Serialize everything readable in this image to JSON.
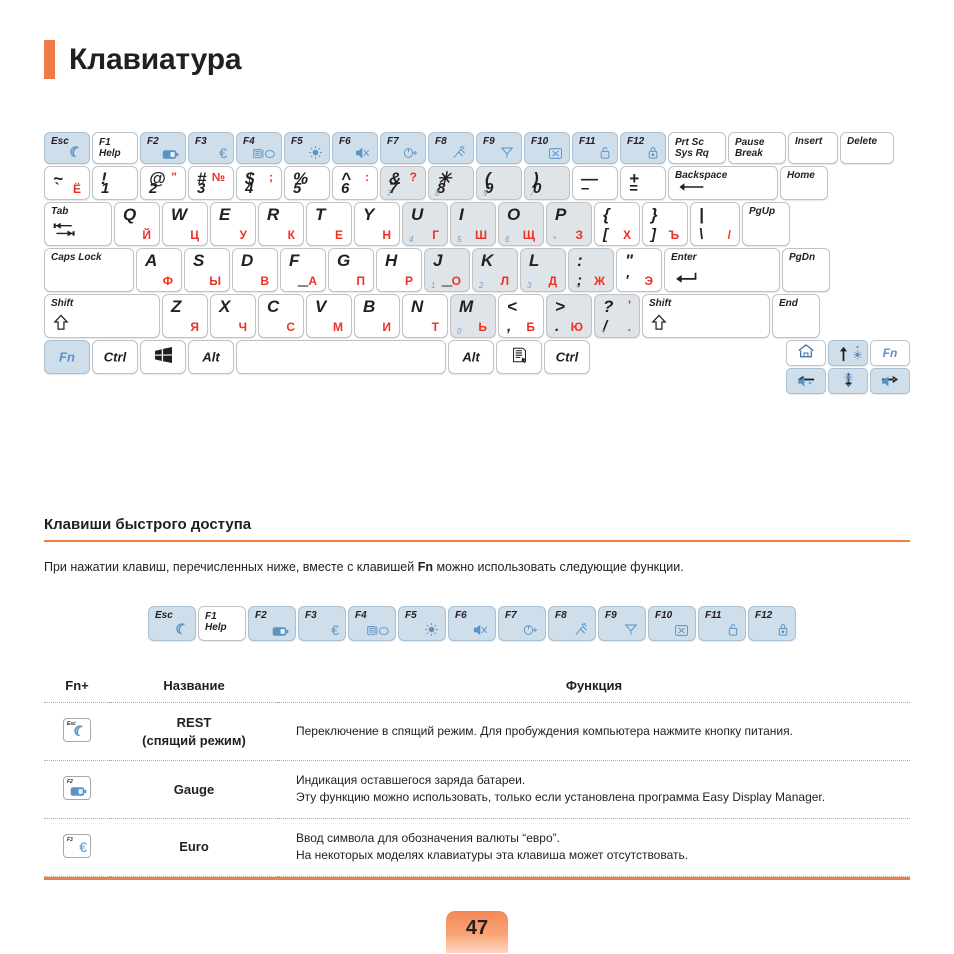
{
  "page": {
    "title": "Клавиатура",
    "number": "47",
    "accent_color": "#f07b47",
    "key_blue": "#cfdeeb",
    "key_numpad": "#dfe4e8",
    "red_label_color": "#ee3124",
    "blue_label_color": "#5b93c6"
  },
  "keyboard": {
    "row_fn": [
      {
        "cap": "Esc",
        "glyph": "moon-icon",
        "style": "blue"
      },
      {
        "cap": "F1",
        "cap2": "Help",
        "style": "white"
      },
      {
        "cap": "F2",
        "glyph": "battery-icon",
        "style": "blue"
      },
      {
        "cap": "F3",
        "glyph": "euro-icon",
        "style": "blue"
      },
      {
        "cap": "F4",
        "glyph": "display-icon",
        "style": "blue"
      },
      {
        "cap": "F5",
        "glyph": "brightness-icon",
        "style": "blue"
      },
      {
        "cap": "F6",
        "glyph": "mute-icon",
        "style": "blue"
      },
      {
        "cap": "F7",
        "glyph": "touchpad-icon",
        "style": "blue"
      },
      {
        "cap": "F8",
        "glyph": "wireless-icon",
        "style": "blue"
      },
      {
        "cap": "F9",
        "glyph": "antenna-icon",
        "style": "blue"
      },
      {
        "cap": "F10",
        "glyph": "screen-off-icon",
        "style": "blue"
      },
      {
        "cap": "F11",
        "glyph": "lock-open-icon",
        "style": "blue"
      },
      {
        "cap": "F12",
        "glyph": "lock-closed-icon",
        "style": "blue"
      },
      {
        "cap": "Prt Sc",
        "cap2": "Sys Rq",
        "style": "white"
      },
      {
        "cap": "Pause",
        "cap2": "Break",
        "style": "white"
      },
      {
        "cap": "Insert",
        "style": "white"
      },
      {
        "cap": "Delete",
        "style": "white"
      }
    ],
    "row_num": [
      {
        "top": "~",
        "bottom": "`",
        "red_br": "Ё",
        "style": "white"
      },
      {
        "top": "!",
        "bottom": "1",
        "style": "white"
      },
      {
        "top": "@",
        "bottom": "2",
        "red_tr": "\"",
        "style": "white"
      },
      {
        "top": "#",
        "bottom": "3",
        "red_tr": "№",
        "style": "white"
      },
      {
        "top": "$",
        "bottom": "4",
        "red_tr": ";",
        "style": "white"
      },
      {
        "top": "%",
        "bottom": "5",
        "style": "white"
      },
      {
        "top": "^",
        "bottom": "6",
        "red_tr": ":",
        "style": "white"
      },
      {
        "top": "&",
        "bottom": "7",
        "red_tr": "?",
        "numpad": "7",
        "style": "numpad"
      },
      {
        "top": "✳",
        "bottom": "8",
        "numpad": "8",
        "style": "numpad"
      },
      {
        "top": "(",
        "bottom": "9",
        "numpad": "9",
        "style": "numpad"
      },
      {
        "top": ")",
        "bottom": "0",
        "numpad": "/",
        "style": "numpad"
      },
      {
        "top": "—",
        "bottom": "–",
        "style": "white"
      },
      {
        "top": "+",
        "bottom": "=",
        "style": "white"
      },
      {
        "cap": "Backspace",
        "glyph": "arrow-left-icon",
        "style": "white"
      },
      {
        "cap": "Home",
        "style": "white"
      }
    ],
    "row_q": [
      {
        "cap": "Tab",
        "glyph": "tab-arrows-icon",
        "style": "white"
      },
      {
        "top": "Q",
        "red_br": "Й",
        "style": "white"
      },
      {
        "top": "W",
        "red_br": "Ц",
        "style": "white"
      },
      {
        "top": "E",
        "red_br": "У",
        "style": "white"
      },
      {
        "top": "R",
        "red_br": "К",
        "style": "white"
      },
      {
        "top": "T",
        "red_br": "Е",
        "style": "white"
      },
      {
        "top": "Y",
        "red_br": "Н",
        "style": "white"
      },
      {
        "top": "U",
        "red_br": "Г",
        "numpad": "4",
        "style": "numpad"
      },
      {
        "top": "I",
        "red_br": "Ш",
        "numpad": "5",
        "style": "numpad"
      },
      {
        "top": "O",
        "red_br": "Щ",
        "numpad": "6",
        "style": "numpad"
      },
      {
        "top": "P",
        "red_br": "З",
        "numpad": "*",
        "style": "numpad"
      },
      {
        "top": "{",
        "bottom": "[",
        "red_br": "Х",
        "style": "white"
      },
      {
        "top": "}",
        "bottom": "]",
        "red_br": "Ъ",
        "style": "white"
      },
      {
        "top": "|",
        "bottom": "\\",
        "red_br": "/",
        "style": "white"
      },
      {
        "cap": "PgUp",
        "style": "white"
      }
    ],
    "row_a": [
      {
        "cap": "Caps Lock",
        "style": "white"
      },
      {
        "top": "A",
        "red_br": "Ф",
        "style": "white"
      },
      {
        "top": "S",
        "red_br": "Ы",
        "style": "white"
      },
      {
        "top": "D",
        "red_br": "В",
        "style": "white"
      },
      {
        "top": "F",
        "red_br": "А",
        "homebar": true,
        "style": "white"
      },
      {
        "top": "G",
        "red_br": "П",
        "style": "white"
      },
      {
        "top": "H",
        "red_br": "Р",
        "style": "white"
      },
      {
        "top": "J",
        "red_br": "О",
        "numpad": "1",
        "homebar": true,
        "style": "numpad"
      },
      {
        "top": "K",
        "red_br": "Л",
        "numpad": "2",
        "style": "numpad"
      },
      {
        "top": "L",
        "red_br": "Д",
        "numpad": "3",
        "style": "numpad"
      },
      {
        "top": ":",
        "bottom": ";",
        "red_br": "Ж",
        "numpad": "-",
        "style": "numpad"
      },
      {
        "top": "\"",
        "bottom": "'",
        "red_br": "Э",
        "style": "white"
      },
      {
        "cap": "Enter",
        "glyph": "enter-arrow-icon",
        "style": "white"
      },
      {
        "cap": "PgDn",
        "style": "white"
      }
    ],
    "row_z": [
      {
        "cap": "Shift",
        "glyph": "shift-up-icon",
        "style": "white"
      },
      {
        "top": "Z",
        "red_br": "Я",
        "style": "white"
      },
      {
        "top": "X",
        "red_br": "Ч",
        "style": "white"
      },
      {
        "top": "C",
        "red_br": "С",
        "style": "white"
      },
      {
        "top": "V",
        "red_br": "М",
        "style": "white"
      },
      {
        "top": "B",
        "red_br": "И",
        "style": "white"
      },
      {
        "top": "N",
        "red_br": "Т",
        "style": "white"
      },
      {
        "top": "M",
        "red_br": "Ь",
        "numpad": "0",
        "style": "numpad"
      },
      {
        "top": "<",
        "bottom": ",",
        "red_br": "Б",
        "style": "white"
      },
      {
        "top": ">",
        "bottom": ".",
        "red_br": "Ю",
        "numpad": ".",
        "style": "numpad"
      },
      {
        "top": "?",
        "bottom": "/",
        "red_tr": "'",
        "red_br": ".",
        "numpad": "+",
        "style": "numpad"
      },
      {
        "cap": "Shift",
        "glyph": "shift-up-icon",
        "style": "white"
      },
      {
        "cap": "End",
        "style": "white"
      }
    ],
    "row_bottom": [
      {
        "cap": "Fn",
        "style": "blue-fn"
      },
      {
        "cap": "Ctrl",
        "style": "white"
      },
      {
        "cap": "windows-icon",
        "style": "white"
      },
      {
        "cap": "Alt",
        "style": "white"
      },
      {
        "cap": "",
        "style": "white"
      },
      {
        "cap": "Alt",
        "style": "white"
      },
      {
        "cap": "menu-icon",
        "style": "white"
      },
      {
        "cap": "Ctrl",
        "style": "white"
      }
    ],
    "arrow_cluster": {
      "top": [
        {
          "glyph": "home-house-icon",
          "style": "white"
        },
        {
          "glyph": "arrow-up-icon",
          "sub": "brightness-up-icon",
          "style": "blue"
        },
        {
          "label": "Fn",
          "style": "white-fn"
        }
      ],
      "bottom": [
        {
          "glyph": "arrow-left-icon",
          "sub": "volume-down-icon",
          "style": "blue"
        },
        {
          "glyph": "arrow-down-icon",
          "sub": "brightness-down-icon",
          "style": "blue"
        },
        {
          "glyph": "arrow-right-icon",
          "sub": "volume-up-icon",
          "style": "blue"
        }
      ]
    }
  },
  "hotkeys_section": {
    "title": "Клавиши быстрого доступа",
    "intro_before": "При нажатии клавиш, перечисленных ниже, вместе с клавишей ",
    "intro_bold": "Fn",
    "intro_after": " можно использовать следующие функции.",
    "strip": [
      {
        "cap": "Esc",
        "glyph": "moon-icon",
        "style": "blue"
      },
      {
        "cap": "F1",
        "cap2": "Help",
        "style": "white"
      },
      {
        "cap": "F2",
        "glyph": "battery-icon",
        "style": "blue"
      },
      {
        "cap": "F3",
        "glyph": "euro-icon",
        "style": "blue"
      },
      {
        "cap": "F4",
        "glyph": "display-icon",
        "style": "blue"
      },
      {
        "cap": "F5",
        "glyph": "brightness-icon",
        "style": "blue"
      },
      {
        "cap": "F6",
        "glyph": "mute-icon",
        "style": "blue"
      },
      {
        "cap": "F7",
        "glyph": "touchpad-icon",
        "style": "blue"
      },
      {
        "cap": "F8",
        "glyph": "wireless-icon",
        "style": "blue"
      },
      {
        "cap": "F9",
        "glyph": "antenna-icon",
        "style": "blue"
      },
      {
        "cap": "F10",
        "glyph": "screen-off-icon",
        "style": "blue"
      },
      {
        "cap": "F11",
        "glyph": "lock-open-icon",
        "style": "blue"
      },
      {
        "cap": "F12",
        "glyph": "lock-closed-icon",
        "style": "blue"
      }
    ]
  },
  "table": {
    "headers": [
      "Fn+",
      "Название",
      "Функция"
    ],
    "rows": [
      {
        "key_cap": "Esc",
        "key_glyph": "moon-icon",
        "name_line1": "REST",
        "name_line2": "(спящий режим)",
        "desc_lines": [
          "Переключение в спящий режим. Для пробуждения компьютера нажмите кнопку питания."
        ]
      },
      {
        "key_cap": "F2",
        "key_glyph": "battery-icon",
        "name_line1": "Gauge",
        "name_line2": "",
        "desc_lines": [
          "Индикация оставшегося заряда батареи.",
          "Эту функцию можно использовать, только если установлена программа Easy Display Manager."
        ]
      },
      {
        "key_cap": "F3",
        "key_glyph": "euro-icon",
        "name_line1": "Euro",
        "name_line2": "",
        "desc_lines": [
          "Ввод символа для обозначения валюты “евро”.",
          "На некоторых моделях клавиатуры эта клавиша может отсутствовать."
        ]
      }
    ]
  }
}
